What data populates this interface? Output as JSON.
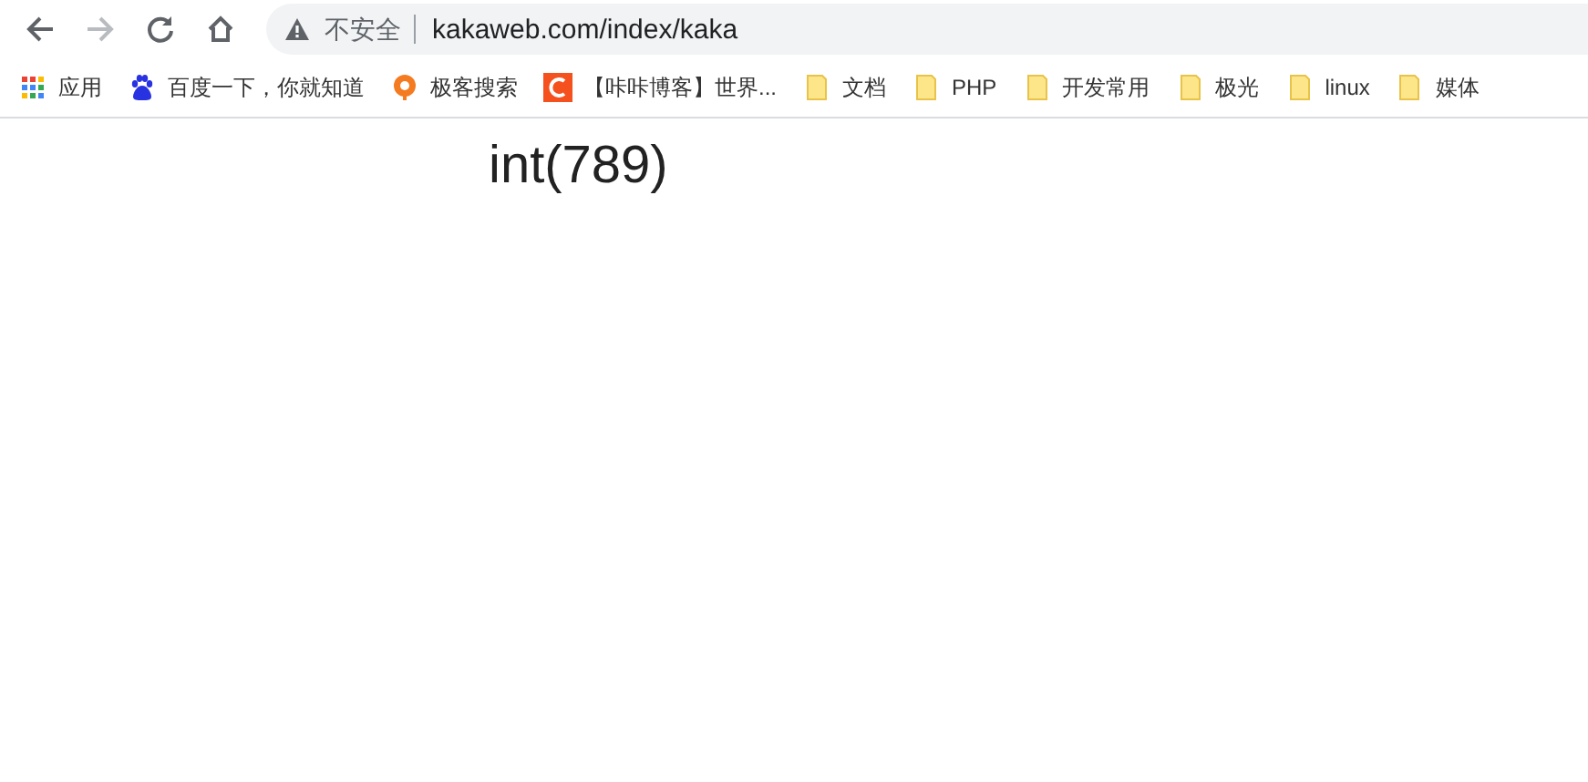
{
  "toolbar": {
    "back": {
      "disabled": false
    },
    "forward": {
      "disabled": true
    },
    "security_label": "不安全",
    "url": "kakaweb.com/index/kaka"
  },
  "bookmarks": [
    {
      "kind": "apps",
      "label": "应用"
    },
    {
      "kind": "baidu",
      "label": "百度一下，你就知道"
    },
    {
      "kind": "jike",
      "label": "极客搜索"
    },
    {
      "kind": "kaka",
      "label": "【咔咔博客】世界..."
    },
    {
      "kind": "folder",
      "label": "文档"
    },
    {
      "kind": "folder",
      "label": "PHP"
    },
    {
      "kind": "folder",
      "label": "开发常用"
    },
    {
      "kind": "folder",
      "label": "极光"
    },
    {
      "kind": "folder",
      "label": "linux"
    },
    {
      "kind": "folder",
      "label": "媒体"
    }
  ],
  "page": {
    "output": "int(789)"
  }
}
